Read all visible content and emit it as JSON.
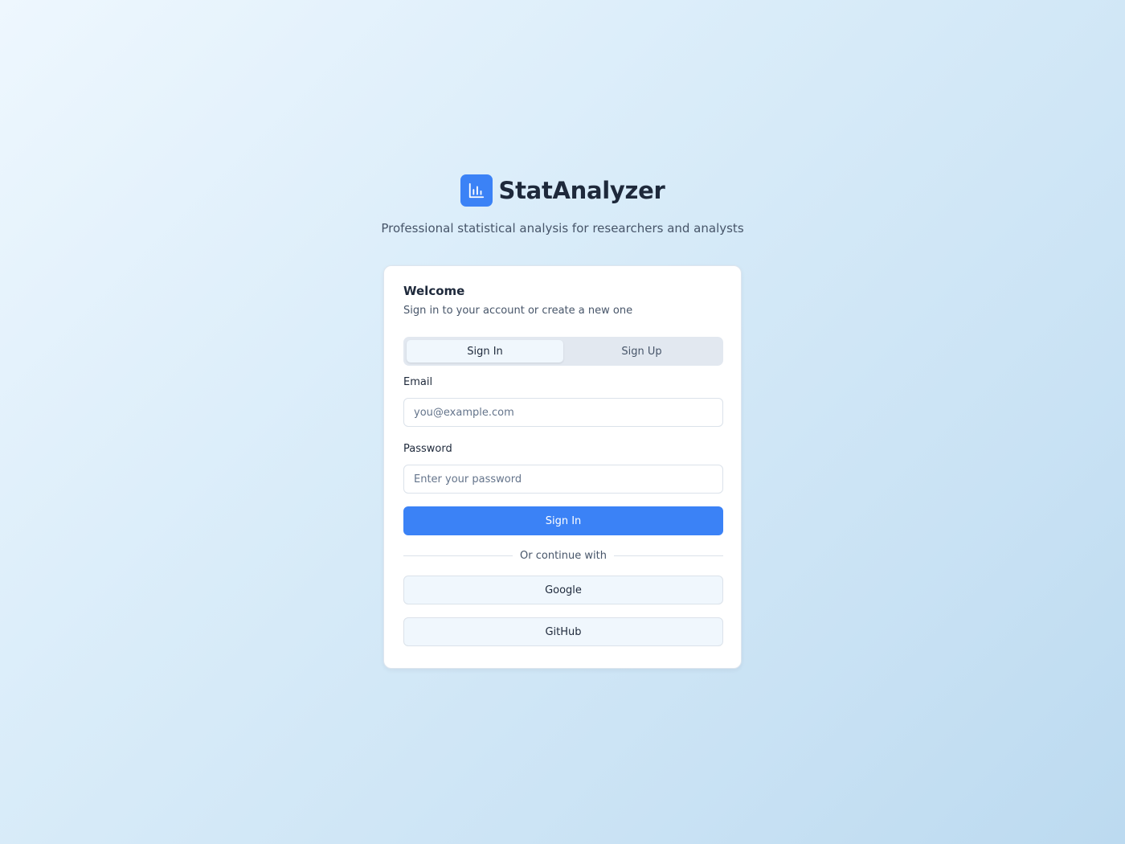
{
  "brand": {
    "name": "StatAnalyzer",
    "logo_icon": "bar-chart-icon",
    "logo_color": "#3b82f6",
    "tagline": "Professional statistical analysis for researchers and analysts"
  },
  "card": {
    "title": "Welcome",
    "subtitle": "Sign in to your account or create a new one"
  },
  "tabs": [
    {
      "label": "Sign In",
      "active": true
    },
    {
      "label": "Sign Up",
      "active": false
    }
  ],
  "form": {
    "email": {
      "label": "Email",
      "placeholder": "you@example.com",
      "value": ""
    },
    "password": {
      "label": "Password",
      "placeholder": "Enter your password",
      "value": ""
    },
    "submit_label": "Sign In"
  },
  "divider_text": "Or continue with",
  "social": [
    {
      "label": "Google"
    },
    {
      "label": "GitHub"
    }
  ],
  "colors": {
    "primary": "#3b82f6",
    "text_dark": "#1e293b",
    "text_muted": "#475569"
  }
}
